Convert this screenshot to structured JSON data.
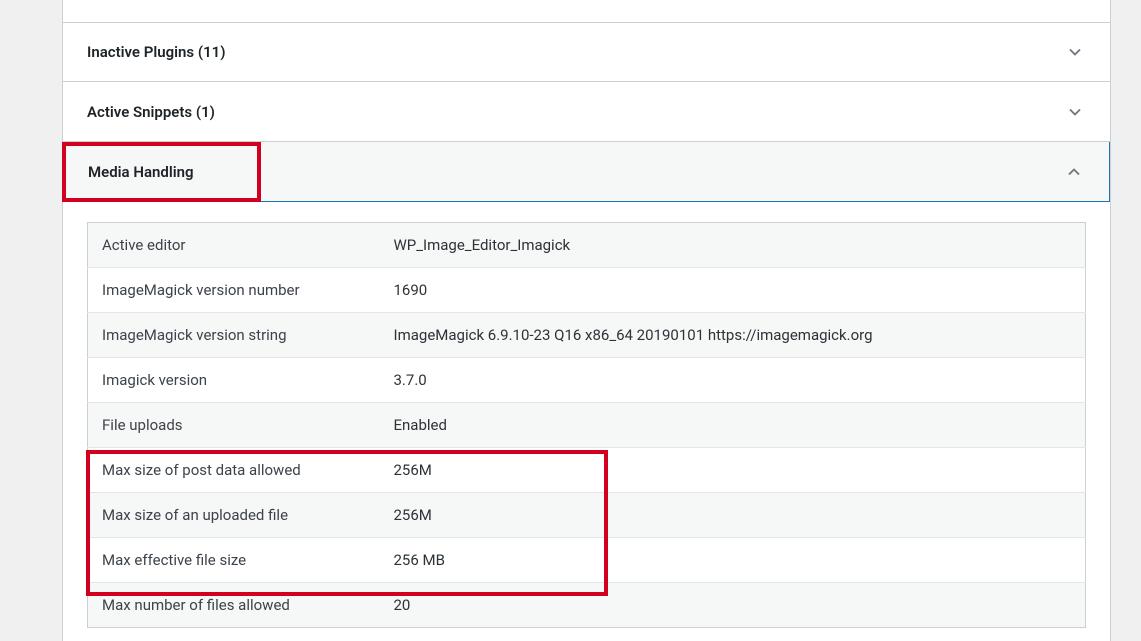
{
  "sections": {
    "inactive_plugins": {
      "label": "Inactive Plugins",
      "count": "(11)"
    },
    "active_snippets": {
      "label": "Active Snippets",
      "count": "(1)"
    },
    "media_handling": {
      "label": "Media Handling"
    }
  },
  "media_rows": [
    {
      "label": "Active editor",
      "value": "WP_Image_Editor_Imagick"
    },
    {
      "label": "ImageMagick version number",
      "value": "1690"
    },
    {
      "label": "ImageMagick version string",
      "value": "ImageMagick 6.9.10-23 Q16 x86_64 20190101 https://imagemagick.org"
    },
    {
      "label": "Imagick version",
      "value": "3.7.0"
    },
    {
      "label": "File uploads",
      "value": "Enabled"
    },
    {
      "label": "Max size of post data allowed",
      "value": "256M"
    },
    {
      "label": "Max size of an uploaded file",
      "value": "256M"
    },
    {
      "label": "Max effective file size",
      "value": "256 MB"
    },
    {
      "label": "Max number of files allowed",
      "value": "20"
    }
  ]
}
